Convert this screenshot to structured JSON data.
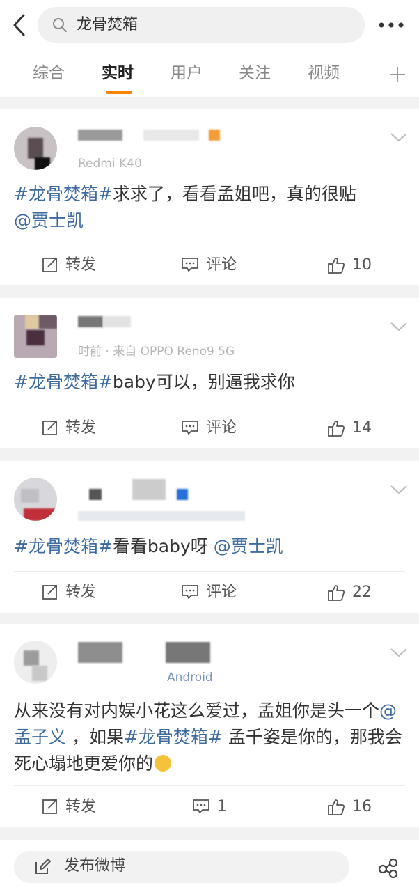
{
  "search": {
    "query": "龙骨焚箱"
  },
  "tabs": [
    "综合",
    "实时",
    "用户",
    "关注",
    "视频"
  ],
  "active_tab": "实时",
  "posts": [
    {
      "source": "Redmi K40",
      "content": [
        {
          "type": "topic",
          "text": "#龙骨焚箱#"
        },
        {
          "type": "text",
          "text": "求求了，看看孟姐吧，真的很贴"
        },
        {
          "type": "mention",
          "text": "@贾士凯"
        }
      ],
      "actions": {
        "repost": "转发",
        "comment": "评论",
        "likes": "10"
      }
    },
    {
      "source": "时前 · 来自 OPPO Reno9 5G",
      "content": [
        {
          "type": "topic",
          "text": "#龙骨焚箱#"
        },
        {
          "type": "text",
          "text": "baby可以，别逼我求你"
        }
      ],
      "actions": {
        "repost": "转发",
        "comment": "评论",
        "likes": "14"
      }
    },
    {
      "source": "",
      "content": [
        {
          "type": "topic",
          "text": "#龙骨焚箱#"
        },
        {
          "type": "text",
          "text": "看看baby呀 "
        },
        {
          "type": "mention",
          "text": "@贾士凯"
        }
      ],
      "actions": {
        "repost": "转发",
        "comment": "评论",
        "likes": "22"
      }
    },
    {
      "source": "Android",
      "content": [
        {
          "type": "text",
          "text": "从来没有对内娱小花这么爱过，孟姐你是头一个"
        },
        {
          "type": "mention",
          "text": "@孟子义"
        },
        {
          "type": "text",
          "text": " ，如果"
        },
        {
          "type": "topic",
          "text": "#龙骨焚箱#"
        },
        {
          "type": "text",
          "text": " 孟千姿是你的，那我会死心塌地更爱你的"
        }
      ],
      "actions": {
        "repost": "转发",
        "comment": "1",
        "likes": "16"
      }
    }
  ],
  "bottom": {
    "compose_label": "发布微博"
  },
  "colors": {
    "accent": "#ff8200",
    "link": "#3e6a9e",
    "background": "#f2f2f2"
  }
}
